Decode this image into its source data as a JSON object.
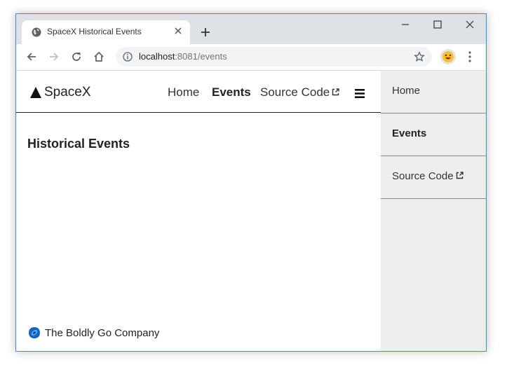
{
  "browser": {
    "tab_title": "SpaceX Historical Events",
    "url_host": "localhost",
    "url_rest": ":8081/events"
  },
  "navbar": {
    "brand": "SpaceX",
    "links": [
      {
        "label": "Home",
        "active": false
      },
      {
        "label": "Events",
        "active": true
      },
      {
        "label": "Source Code",
        "active": false,
        "external": true
      }
    ]
  },
  "main": {
    "title": "Historical Events"
  },
  "footer": {
    "text": "The Boldly Go Company"
  },
  "drawer": {
    "items": [
      {
        "label": "Home",
        "active": false
      },
      {
        "label": "Events",
        "active": true
      },
      {
        "label": "Source Code",
        "active": false,
        "external": true
      }
    ]
  },
  "colors": {
    "accent_border": "#3a8ee6",
    "drawer_bg": "#eeeeee",
    "footer_logo": "#1565c0"
  },
  "icons": {
    "favicon": "globe-icon",
    "external": "external-link-icon",
    "menu": "hamburger-icon"
  }
}
